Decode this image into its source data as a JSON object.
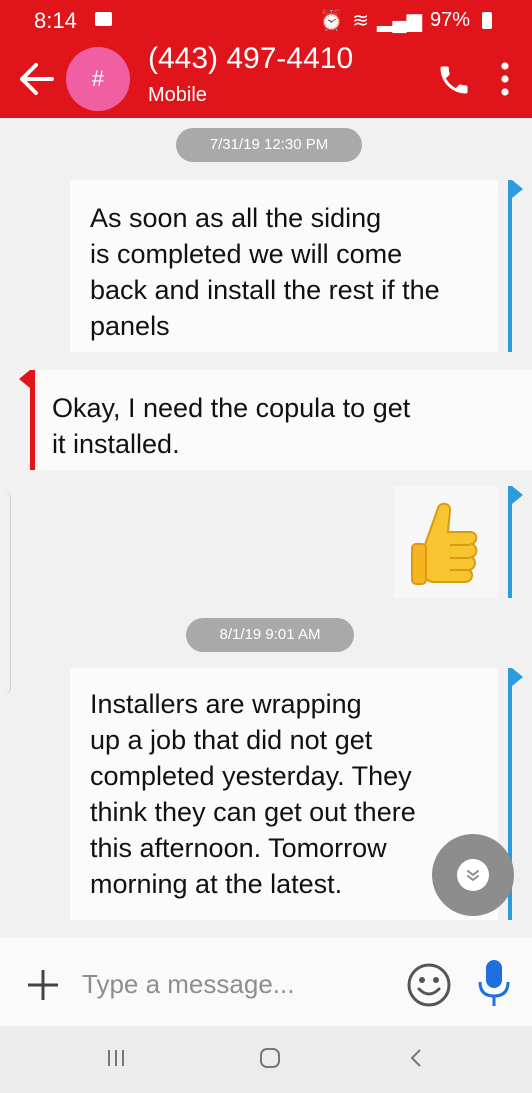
{
  "status_bar": {
    "time": "8:14",
    "battery": "97%"
  },
  "header": {
    "avatar_initial": "#",
    "contact_number": "(443) 497-4410",
    "contact_type": "Mobile"
  },
  "conversation": {
    "timestamps": [
      "7/31/19 12:30 PM",
      "8/1/19 9:01 AM"
    ],
    "messages": [
      {
        "direction": "outgoing",
        "text": "As soon as all the siding\nis completed we will come\nback and install the rest if the\npanels"
      },
      {
        "direction": "incoming",
        "text": "Okay, I need the copula  to get\nit installed."
      },
      {
        "direction": "outgoing",
        "text": "",
        "emoji": "thumbs-up"
      },
      {
        "direction": "outgoing",
        "text": "Installers are wrapping\nup a job that did not get\ncompleted yesterday. They\nthink they can get out there\nthis afternoon. Tomorrow\nmorning at the latest."
      }
    ]
  },
  "composer": {
    "placeholder": "Type a message..."
  },
  "colors": {
    "brand": "#e0151c",
    "avatar": "#ef5fa1",
    "outgoing_marker": "#2a9bdc",
    "incoming_marker": "#e0151c"
  }
}
